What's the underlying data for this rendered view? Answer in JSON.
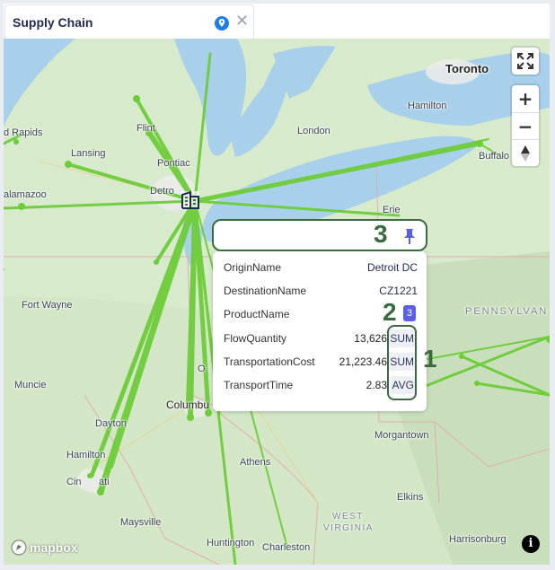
{
  "tab": {
    "title": "Supply Chain",
    "pin_icon": "location-pin-icon",
    "close_label": "✕"
  },
  "map": {
    "labels": {
      "toronto": "Toronto",
      "hamilton_on": "Hamilton",
      "london": "London",
      "buffalo": "Buffalo",
      "erie": "Erie",
      "rapids": "d Rapids",
      "flint": "Flint",
      "lansing": "Lansing",
      "pontiac": "Pontiac",
      "detroit": "Detro",
      "kalamazoo": "alamazoo",
      "fort_wayne": "Fort Wayne",
      "pennsylvania": "PENNSYLVAN",
      "muncie": "Muncie",
      "dayton": "Dayton",
      "columbus": "Columbu",
      "hamilton_oh": "Hamilton",
      "cincinnati_a": "Cin",
      "cincinnati_b": "ati",
      "athens": "Athens",
      "morgantown": "Morgantown",
      "elkins": "Elkins",
      "west_virginia_1": "WEST",
      "west_virginia_2": "VIRGINIA",
      "maysville": "Maysville",
      "huntington": "Huntington",
      "charleston": "Charleston",
      "harrisonburg": "Harrisonburg",
      "o_partial": "O"
    },
    "attribution": "mapbox",
    "zoom_in": "+",
    "zoom_out": "−",
    "compass": "▲"
  },
  "popup": {
    "annotation_3": "3",
    "annotation_2": "2",
    "annotation_1": "1",
    "rows": [
      {
        "key": "OriginName",
        "value": "Detroit DC"
      },
      {
        "key": "DestinationName",
        "value": "CZ1221"
      },
      {
        "key": "ProductName",
        "badge": "3"
      },
      {
        "key": "FlowQuantity",
        "value": "13,626",
        "agg": "SUM"
      },
      {
        "key": "TransportationCost",
        "value": "21,223.46",
        "agg": "SUM"
      },
      {
        "key": "TransportTime",
        "value": "2.83",
        "agg": "AVG"
      }
    ]
  },
  "colors": {
    "flow": "#6dcc3a",
    "water": "#a9d0ea",
    "land": "#d9ebcf",
    "annotation": "#3b6a3f",
    "badge": "#5b5ee6"
  }
}
